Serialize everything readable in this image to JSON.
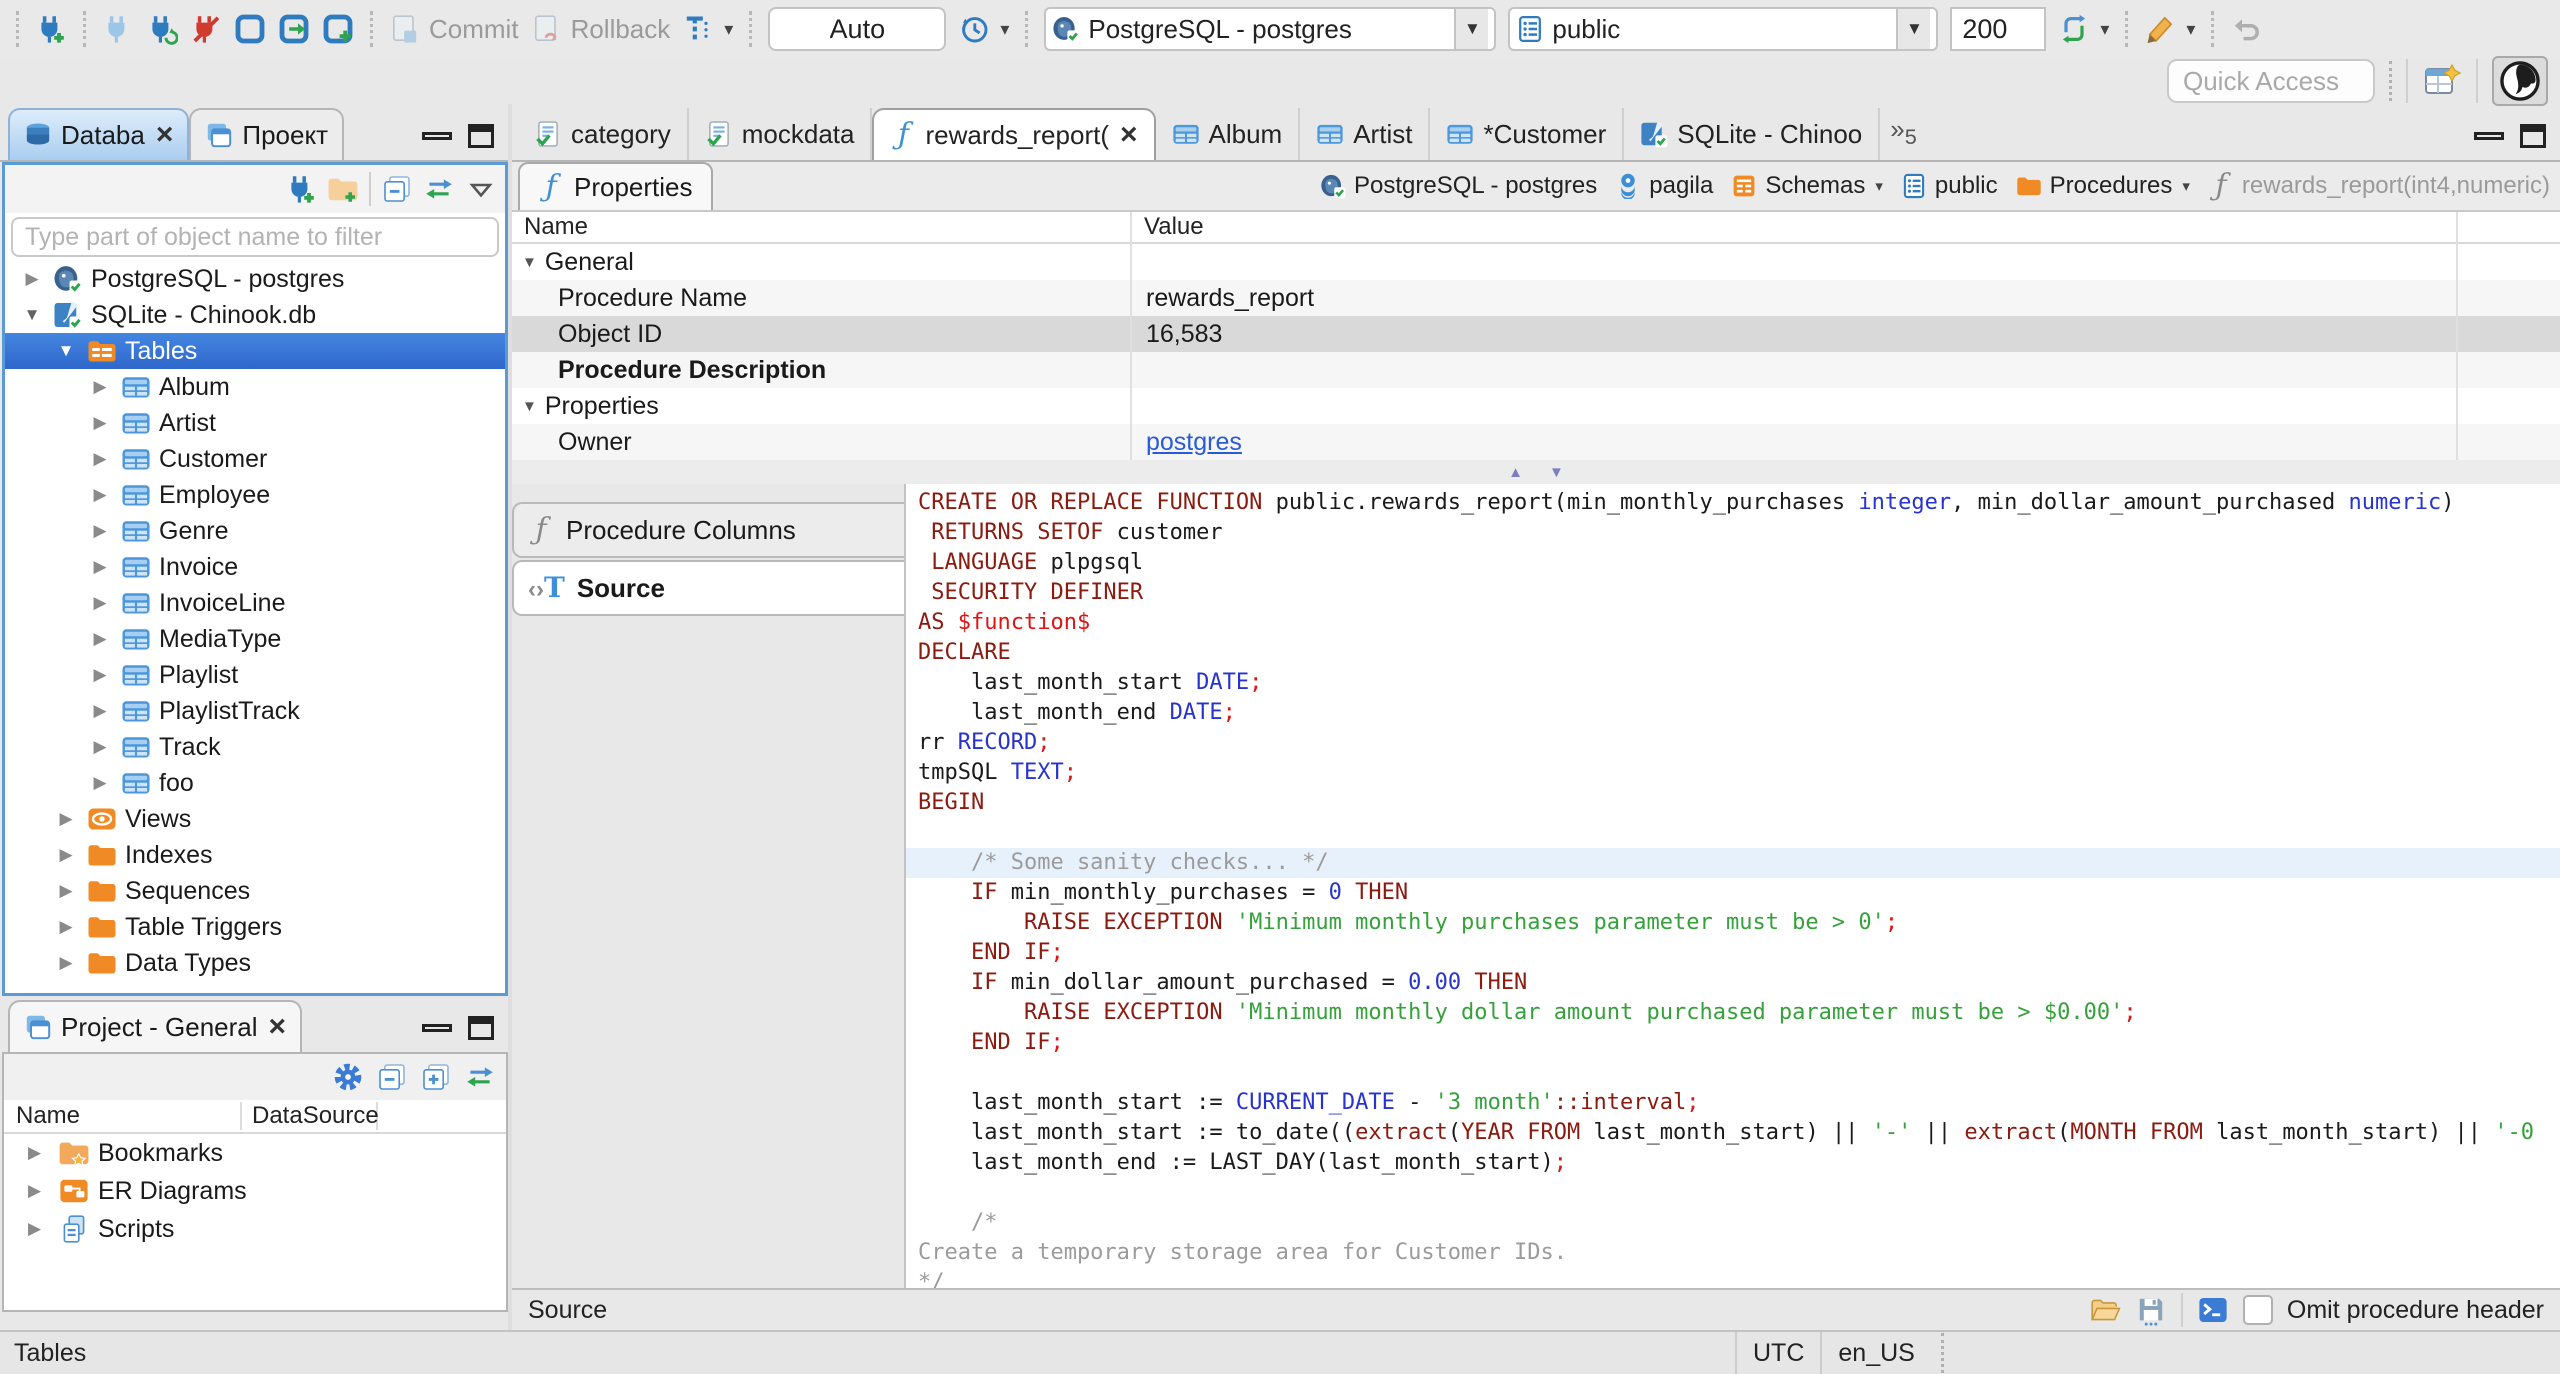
{
  "toolbar": {
    "commit_label": "Commit",
    "rollback_label": "Rollback",
    "auto_label": "Auto",
    "connection_value": "PostgreSQL - postgres",
    "schema_value": "public",
    "fetch_size_value": "200",
    "quick_access_placeholder": "Quick Access"
  },
  "left_tabs": {
    "database_label": "Databa",
    "project_label": "Проект"
  },
  "sidebar": {
    "filter_placeholder": "Type part of object name to filter",
    "tree": [
      {
        "label": "PostgreSQL - postgres",
        "icon": "postgres",
        "level": 0,
        "exp": "collapsed"
      },
      {
        "label": "SQLite - Chinook.db",
        "icon": "sqlite",
        "level": 0,
        "exp": "expanded"
      },
      {
        "label": "Tables",
        "icon": "tables",
        "level": 1,
        "exp": "expanded",
        "selected": true
      },
      {
        "label": "Album",
        "icon": "table",
        "level": 2,
        "exp": "collapsed"
      },
      {
        "label": "Artist",
        "icon": "table",
        "level": 2,
        "exp": "collapsed"
      },
      {
        "label": "Customer",
        "icon": "table",
        "level": 2,
        "exp": "collapsed"
      },
      {
        "label": "Employee",
        "icon": "table",
        "level": 2,
        "exp": "collapsed"
      },
      {
        "label": "Genre",
        "icon": "table",
        "level": 2,
        "exp": "collapsed"
      },
      {
        "label": "Invoice",
        "icon": "table",
        "level": 2,
        "exp": "collapsed"
      },
      {
        "label": "InvoiceLine",
        "icon": "table",
        "level": 2,
        "exp": "collapsed"
      },
      {
        "label": "MediaType",
        "icon": "table",
        "level": 2,
        "exp": "collapsed"
      },
      {
        "label": "Playlist",
        "icon": "table",
        "level": 2,
        "exp": "collapsed"
      },
      {
        "label": "PlaylistTrack",
        "icon": "table",
        "level": 2,
        "exp": "collapsed"
      },
      {
        "label": "Track",
        "icon": "table",
        "level": 2,
        "exp": "collapsed"
      },
      {
        "label": "foo",
        "icon": "table",
        "level": 2,
        "exp": "collapsed"
      },
      {
        "label": "Views",
        "icon": "views",
        "level": 1,
        "exp": "collapsed"
      },
      {
        "label": "Indexes",
        "icon": "folder",
        "level": 1,
        "exp": "collapsed"
      },
      {
        "label": "Sequences",
        "icon": "folder",
        "level": 1,
        "exp": "collapsed"
      },
      {
        "label": "Table Triggers",
        "icon": "folder",
        "level": 1,
        "exp": "collapsed"
      },
      {
        "label": "Data Types",
        "icon": "folder",
        "level": 1,
        "exp": "collapsed"
      }
    ]
  },
  "project_panel": {
    "title": "Project - General",
    "columns": [
      "Name",
      "DataSource"
    ],
    "rows": [
      {
        "label": "Bookmarks",
        "icon": "bookmarks"
      },
      {
        "label": "ER Diagrams",
        "icon": "erd"
      },
      {
        "label": "Scripts",
        "icon": "scripts"
      }
    ]
  },
  "statusbar": {
    "left": "Tables",
    "timezone": "UTC",
    "locale": "en_US"
  },
  "editor": {
    "tabs": [
      {
        "label": "category",
        "icon": "script"
      },
      {
        "label": "mockdata",
        "icon": "script"
      },
      {
        "label": "rewards_report(",
        "icon": "fn",
        "active": true,
        "closable": true
      },
      {
        "label": "Album",
        "icon": "table"
      },
      {
        "label": "Artist",
        "icon": "table"
      },
      {
        "label": "*Customer",
        "icon": "table"
      },
      {
        "label": "SQLite - Chinoo",
        "icon": "sqlite"
      }
    ],
    "overflow_count": "5",
    "properties_tab_label": "Properties",
    "breadcrumb": [
      {
        "label": "PostgreSQL - postgres",
        "icon": "postgres"
      },
      {
        "label": "pagila",
        "icon": "database"
      },
      {
        "label": "Schemas",
        "icon": "schemas",
        "dropdown": true
      },
      {
        "label": "public",
        "icon": "schema"
      },
      {
        "label": "Procedures",
        "icon": "folder",
        "dropdown": true
      },
      {
        "label": "rewards_report(int4,numeric)",
        "icon": "fngray",
        "muted": true
      }
    ],
    "properties_grid": {
      "columns": [
        "Name",
        "Value"
      ],
      "rows": [
        {
          "name": "General",
          "value": "",
          "group": true
        },
        {
          "name": "Procedure Name",
          "value": "rewards_report"
        },
        {
          "name": "Object ID",
          "value": "16,583",
          "selected": true
        },
        {
          "name": "Procedure Description",
          "value": "",
          "bold": true
        },
        {
          "name": "Properties",
          "value": "",
          "group": true
        },
        {
          "name": "Owner",
          "value": "postgres",
          "link": true
        }
      ]
    },
    "side_tabs": [
      {
        "label": "Procedure Columns",
        "icon": "fngray"
      },
      {
        "label": "Source",
        "icon": "source",
        "active": true
      }
    ],
    "footer": {
      "label": "Source",
      "checkbox_label": "Omit procedure header",
      "checkbox_checked": false
    }
  },
  "code": {
    "lines": [
      {
        "hl": false,
        "t": [
          [
            "k",
            "CREATE OR REPLACE FUNCTION"
          ],
          [
            "d",
            " public.rewards_report(min_monthly_purchases "
          ],
          [
            "t",
            "integer"
          ],
          [
            "d",
            ", min_dollar_amount_purchased "
          ],
          [
            "t",
            "numeric"
          ],
          [
            "d",
            ")"
          ]
        ]
      },
      {
        "hl": false,
        "t": [
          [
            "k",
            " RETURNS SETOF"
          ],
          [
            "d",
            " customer"
          ]
        ]
      },
      {
        "hl": false,
        "t": [
          [
            "k",
            " LANGUAGE"
          ],
          [
            "d",
            " plpgsql"
          ]
        ]
      },
      {
        "hl": false,
        "t": [
          [
            "k",
            " SECURITY DEFINER"
          ]
        ]
      },
      {
        "hl": false,
        "t": [
          [
            "k",
            "AS "
          ],
          [
            "r",
            "$function$"
          ]
        ]
      },
      {
        "hl": false,
        "t": [
          [
            "k",
            "DECLARE"
          ]
        ]
      },
      {
        "hl": false,
        "t": [
          [
            "d",
            "    last_month_start "
          ],
          [
            "t",
            "DATE"
          ],
          [
            "r",
            ";"
          ]
        ]
      },
      {
        "hl": false,
        "t": [
          [
            "d",
            "    last_month_end "
          ],
          [
            "t",
            "DATE"
          ],
          [
            "r",
            ";"
          ]
        ]
      },
      {
        "hl": false,
        "t": [
          [
            "d",
            "rr "
          ],
          [
            "t",
            "RECORD"
          ],
          [
            "r",
            ";"
          ]
        ]
      },
      {
        "hl": false,
        "t": [
          [
            "d",
            "tmpSQL "
          ],
          [
            "t",
            "TEXT"
          ],
          [
            "r",
            ";"
          ]
        ]
      },
      {
        "hl": false,
        "t": [
          [
            "k",
            "BEGIN"
          ]
        ]
      },
      {
        "hl": false,
        "t": []
      },
      {
        "hl": true,
        "t": [
          [
            "c",
            "    /* Some sanity checks... */"
          ]
        ]
      },
      {
        "hl": false,
        "t": [
          [
            "k",
            "    IF"
          ],
          [
            "d",
            " min_monthly_purchases = "
          ],
          [
            "t",
            "0"
          ],
          [
            "k",
            " THEN"
          ]
        ]
      },
      {
        "hl": false,
        "t": [
          [
            "k",
            "        RAISE EXCEPTION"
          ],
          [
            "s",
            " 'Minimum monthly purchases parameter must be > 0'"
          ],
          [
            "r",
            ";"
          ]
        ]
      },
      {
        "hl": false,
        "t": [
          [
            "k",
            "    END IF"
          ],
          [
            "r",
            ";"
          ]
        ]
      },
      {
        "hl": false,
        "t": [
          [
            "k",
            "    IF"
          ],
          [
            "d",
            " min_dollar_amount_purchased = "
          ],
          [
            "t",
            "0.00"
          ],
          [
            "k",
            " THEN"
          ]
        ]
      },
      {
        "hl": false,
        "t": [
          [
            "k",
            "        RAISE EXCEPTION"
          ],
          [
            "s",
            " 'Minimum monthly dollar amount purchased parameter must be > $0.00'"
          ],
          [
            "r",
            ";"
          ]
        ]
      },
      {
        "hl": false,
        "t": [
          [
            "k",
            "    END IF"
          ],
          [
            "r",
            ";"
          ]
        ]
      },
      {
        "hl": false,
        "t": []
      },
      {
        "hl": false,
        "t": [
          [
            "d",
            "    last_month_start := "
          ],
          [
            "t",
            "CURRENT_DATE"
          ],
          [
            "d",
            " - "
          ],
          [
            "s",
            "'3 month'"
          ],
          [
            "k",
            "::interval"
          ],
          [
            "r",
            ";"
          ]
        ]
      },
      {
        "hl": false,
        "t": [
          [
            "d",
            "    last_month_start := to_date(("
          ],
          [
            "k",
            "extract"
          ],
          [
            "d",
            "("
          ],
          [
            "k",
            "YEAR FROM"
          ],
          [
            "d",
            " last_month_start) || "
          ],
          [
            "s",
            "'-'"
          ],
          [
            "d",
            " || "
          ],
          [
            "k",
            "extract"
          ],
          [
            "d",
            "("
          ],
          [
            "k",
            "MONTH FROM"
          ],
          [
            "d",
            " last_month_start) || "
          ],
          [
            "s",
            "'-0"
          ]
        ]
      },
      {
        "hl": false,
        "t": [
          [
            "d",
            "    last_month_end := LAST_DAY(last_month_start)"
          ],
          [
            "r",
            ";"
          ]
        ]
      },
      {
        "hl": false,
        "t": []
      },
      {
        "hl": false,
        "t": [
          [
            "c",
            "    /*"
          ]
        ]
      },
      {
        "hl": false,
        "t": [
          [
            "c",
            "Create a temporary storage area for Customer IDs."
          ]
        ]
      },
      {
        "hl": false,
        "t": [
          [
            "c",
            "*/"
          ]
        ]
      }
    ]
  }
}
